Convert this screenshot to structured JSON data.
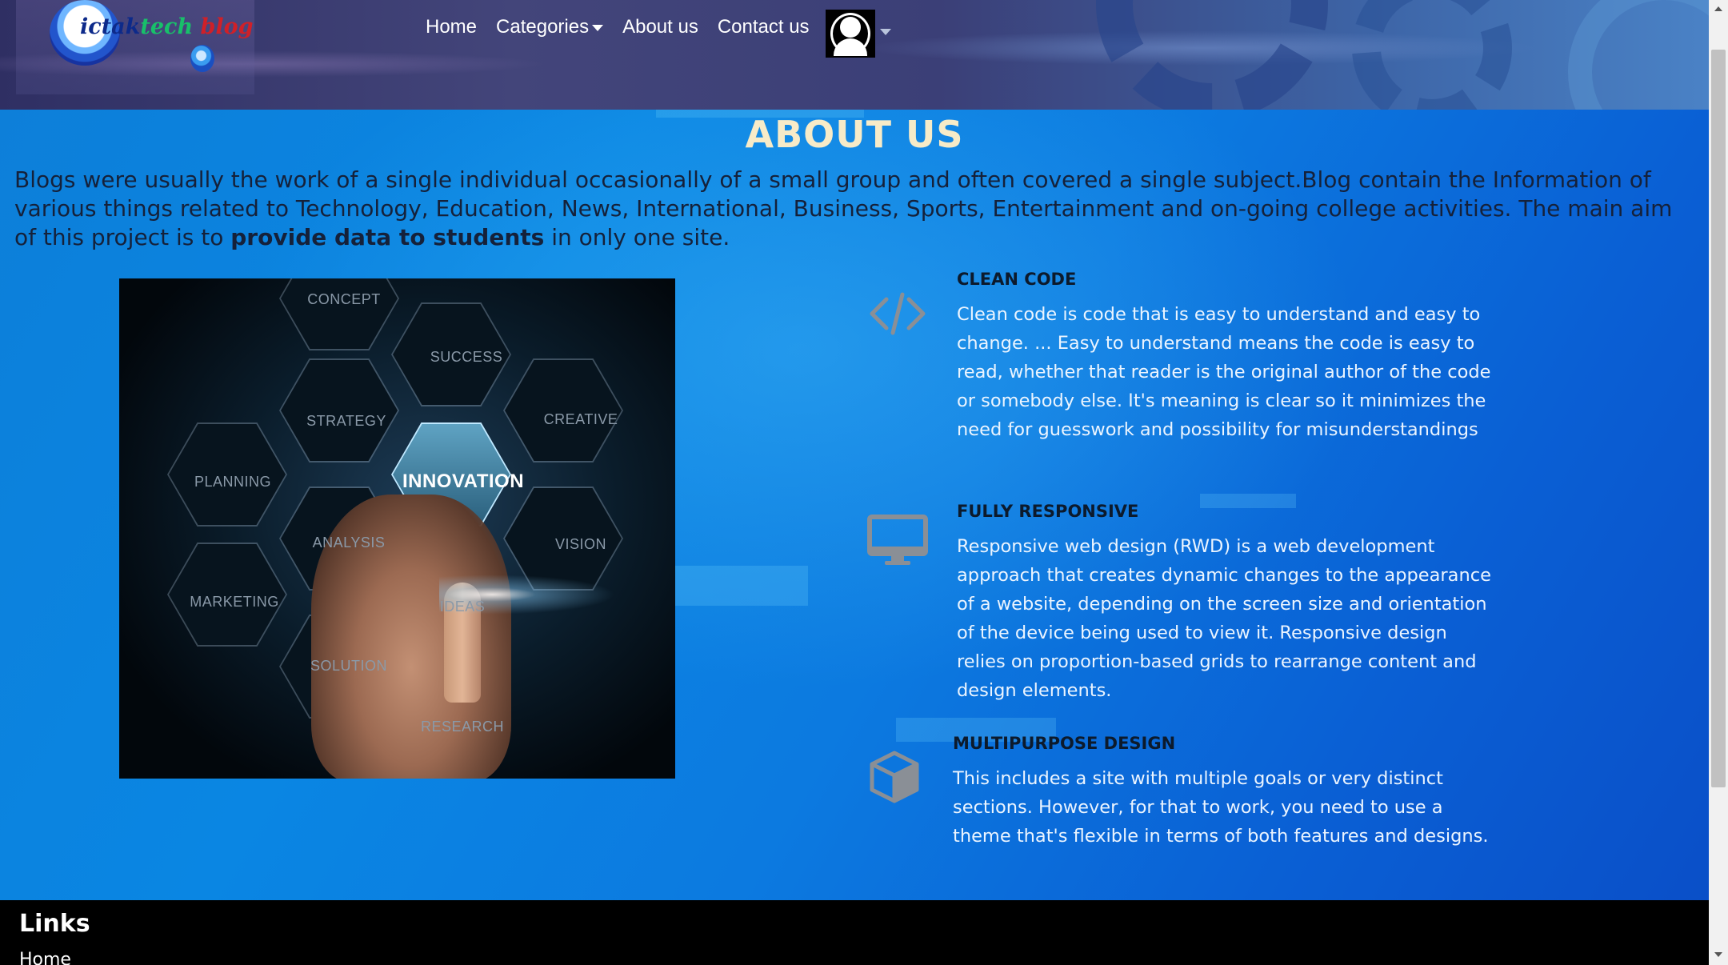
{
  "logo": {
    "text_part1": "i",
    "text_part2": "ctak",
    "text_part3": "tech",
    "text_part4": "blog"
  },
  "nav": {
    "items": [
      {
        "label": "Home"
      },
      {
        "label": "Categories"
      },
      {
        "label": "About us"
      },
      {
        "label": "Contact us"
      }
    ],
    "avatar_icon": "user-avatar-icon"
  },
  "main": {
    "title": "ABOUT US",
    "intro_before": "Blogs were usually the work of a single individual occasionally of a small group and often covered a single subject.Blog contain the Information of various things related to Technology, Education, News, International, Business, Sports, Entertainment and on-going college activities. The main aim of this project is to ",
    "intro_bold": "provide data to students",
    "intro_after": " in only one site.",
    "hero_labels": {
      "concept": "CONCEPT",
      "success": "SUCCESS",
      "strategy": "STRATEGY",
      "creative": "CREATIVE",
      "planning": "PLANNING",
      "innovation": "INNOVATION",
      "analysis": "ANALYSIS",
      "vision": "VISION",
      "marketing": "MARKETING",
      "ideas": "IDEAS",
      "solution": "SOLUTION",
      "research": "RESEARCH"
    },
    "features": [
      {
        "icon": "code-icon",
        "title": "CLEAN CODE",
        "desc": "Clean code is code that is easy to understand and easy to change. ... Easy to understand means the code is easy to read, whether that reader is the original author of the code or somebody else. It's meaning is clear so it minimizes the need for guesswork and possibility for misunderstandings"
      },
      {
        "icon": "desktop-icon",
        "title": "FULLY RESPONSIVE",
        "desc": "Responsive web design (RWD) is a web development approach that creates dynamic changes to the appearance of a website, depending on the screen size and orientation of the device being used to view it. Responsive design relies on proportion-based grids to rearrange content and design elements."
      },
      {
        "icon": "cube-icon",
        "title": "MULTIPURPOSE DESIGN",
        "desc": "This includes a site with multiple goals or very distinct sections. However, for that to work, you need to use a theme that's flexible in terms of both features and designs."
      }
    ]
  },
  "footer": {
    "title": "Links",
    "first_link": "Home"
  },
  "colors": {
    "title": "#f7ebc8",
    "intro_text": "#15213a",
    "feature_desc": "#eaf4ff",
    "icon_gray": "#8a8f96"
  }
}
